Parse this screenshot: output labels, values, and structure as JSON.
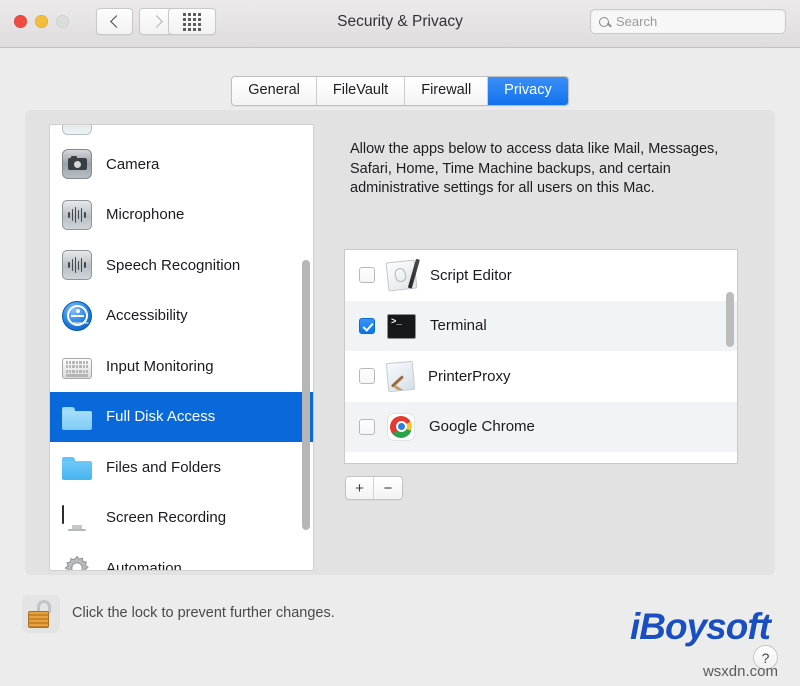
{
  "window": {
    "title": "Security & Privacy",
    "traffic_lights": [
      "close",
      "minimize",
      "zoom"
    ]
  },
  "toolbar": {
    "back_label": "Back",
    "forward_label": "Forward",
    "grid_label": "Show All",
    "search_placeholder": "Search",
    "search_value": ""
  },
  "tabs": [
    {
      "label": "General",
      "active": false
    },
    {
      "label": "FileVault",
      "active": false
    },
    {
      "label": "Firewall",
      "active": false
    },
    {
      "label": "Privacy",
      "active": true
    }
  ],
  "sidebar": {
    "items": [
      {
        "label": "Camera",
        "icon": "camera-icon",
        "selected": false
      },
      {
        "label": "Microphone",
        "icon": "microphone-icon",
        "selected": false
      },
      {
        "label": "Speech Recognition",
        "icon": "speech-recognition-icon",
        "selected": false
      },
      {
        "label": "Accessibility",
        "icon": "accessibility-icon",
        "selected": false
      },
      {
        "label": "Input Monitoring",
        "icon": "keyboard-icon",
        "selected": false
      },
      {
        "label": "Full Disk Access",
        "icon": "folder-icon",
        "selected": true
      },
      {
        "label": "Files and Folders",
        "icon": "folder-icon",
        "selected": false
      },
      {
        "label": "Screen Recording",
        "icon": "monitor-icon",
        "selected": false
      },
      {
        "label": "Automation",
        "icon": "gear-icon",
        "selected": false
      }
    ]
  },
  "main": {
    "description": "Allow the apps below to access data like Mail, Messages, Safari, Home, Time Machine backups, and certain administrative settings for all users on this Mac.",
    "apps": [
      {
        "name": "Script Editor",
        "icon": "script-editor-icon",
        "checked": false
      },
      {
        "name": "Terminal",
        "icon": "terminal-icon",
        "checked": true
      },
      {
        "name": "PrinterProxy",
        "icon": "printerproxy-icon",
        "checked": false
      },
      {
        "name": "Google Chrome",
        "icon": "google-chrome-icon",
        "checked": false
      }
    ],
    "add_label": "+",
    "remove_label": "−"
  },
  "footer": {
    "lock_text": "Click the lock to prevent further changes.",
    "lock_state": "unlocked",
    "help_label": "?"
  },
  "watermark": {
    "brand": "iBoysoft",
    "url": "wsxdn.com"
  },
  "colors": {
    "accent_blue": "#0a69da",
    "tab_active": "#1272ec",
    "checkbox_checked": "#0a74ec",
    "window_bg": "#ececec",
    "panel_bg": "#e2e2e2",
    "watermark_blue": "#1a4fc4"
  }
}
